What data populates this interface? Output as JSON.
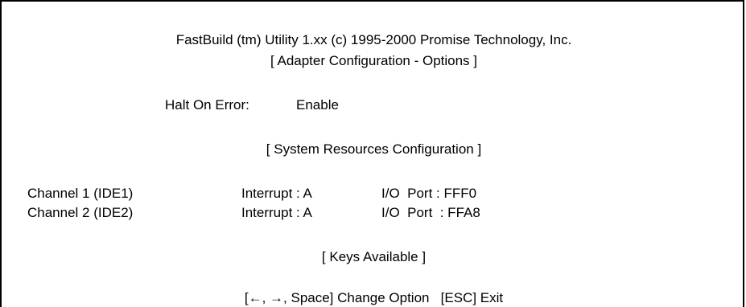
{
  "header": {
    "title": "FastBuild (tm) Utility 1.xx (c) 1995-2000 Promise Technology, Inc.",
    "subtitle": "[ Adapter Configuration - Options ]"
  },
  "options": {
    "halt_on_error_label": "Halt On Error:",
    "halt_on_error_value": "Enable"
  },
  "system_resources": {
    "heading": "[ System Resources Configuration ]",
    "channels": [
      {
        "name": "Channel 1 (IDE1)",
        "interrupt": "Interrupt : A",
        "io_port": "I/O  Port : FFF0"
      },
      {
        "name": "Channel 2 (IDE2)",
        "interrupt": "Interrupt : A",
        "io_port": "I/O  Port  : FFA8"
      }
    ]
  },
  "keys": {
    "heading": "[ Keys Available ]",
    "help": "[←, →, Space] Change Option   [ESC] Exit"
  },
  "colors": {
    "background": "#ffffff",
    "text": "#000000",
    "border": "#000000"
  }
}
